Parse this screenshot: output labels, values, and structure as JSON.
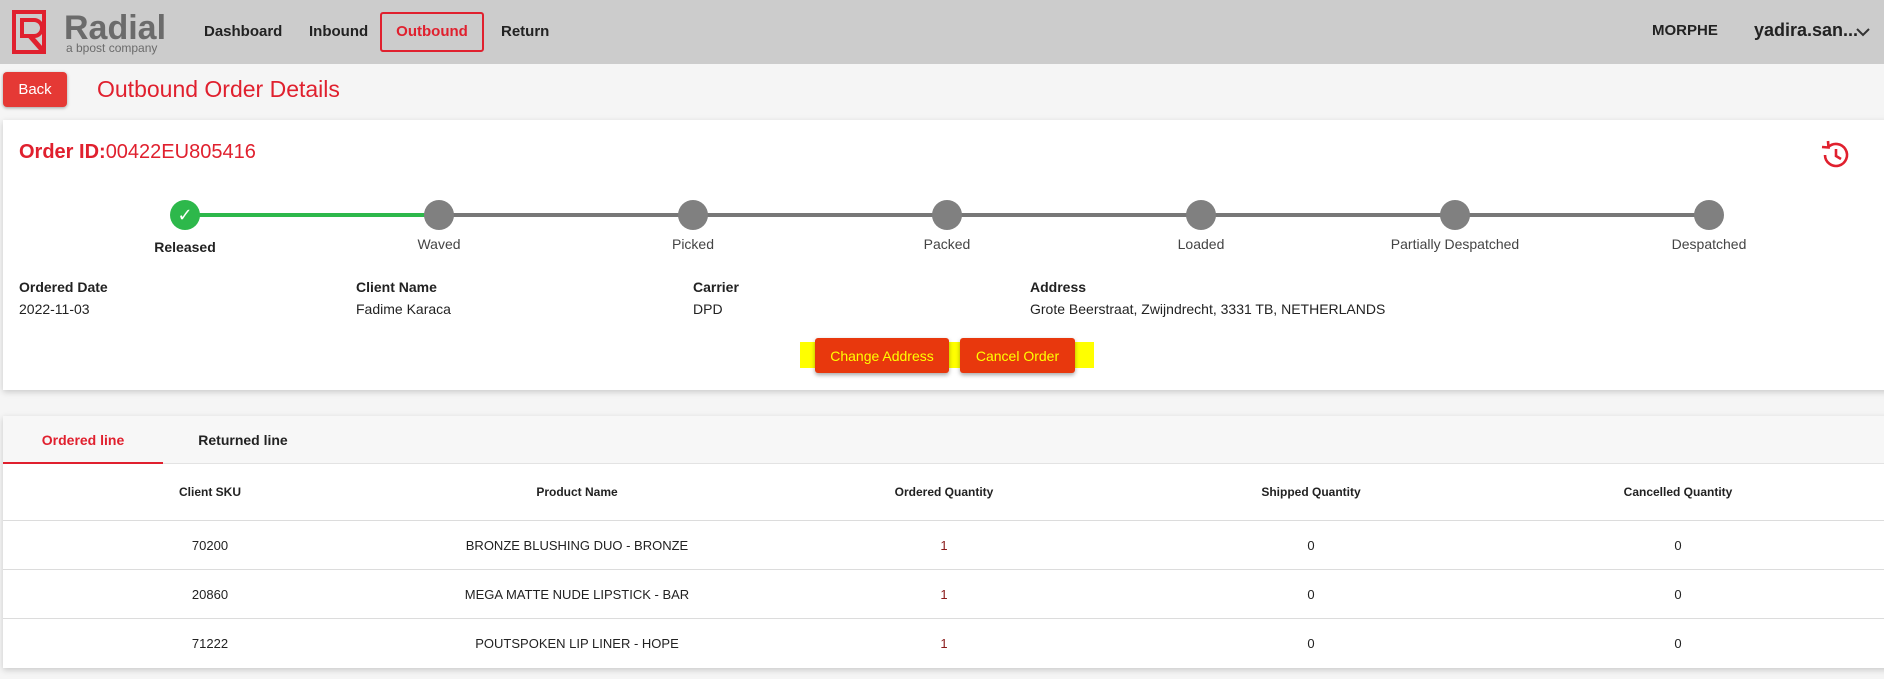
{
  "brand": {
    "name": "Radial",
    "tagline": "a bpost company",
    "color": "#e0202e"
  },
  "nav": {
    "items": [
      {
        "label": "Dashboard",
        "active": false
      },
      {
        "label": "Inbound",
        "active": false
      },
      {
        "label": "Outbound",
        "active": true
      },
      {
        "label": "Return",
        "active": false
      }
    ],
    "client": "MORPHE",
    "user": "yadira.san..."
  },
  "header": {
    "back_label": "Back",
    "title": "Outbound Order Details"
  },
  "order": {
    "id_label": "Order ID:",
    "id_value": "00422EU805416",
    "history_icon": "history-icon"
  },
  "progress": {
    "current_step": "Released",
    "steps": [
      "Released",
      "Waved",
      "Picked",
      "Packed",
      "Loaded",
      "Partially Despatched",
      "Despatched"
    ]
  },
  "details": {
    "ordered_date": {
      "label": "Ordered Date",
      "value": "2022-11-03"
    },
    "client_name": {
      "label": "Client Name",
      "value": "Fadime Karaca"
    },
    "carrier": {
      "label": "Carrier",
      "value": "DPD"
    },
    "address": {
      "label": "Address",
      "value": "Grote Beerstraat, Zwijndrecht, 3331 TB, NETHERLANDS"
    }
  },
  "actions": {
    "change_address": "Change Address",
    "cancel_order": "Cancel Order"
  },
  "tabs": [
    {
      "label": "Ordered line",
      "active": true
    },
    {
      "label": "Returned line",
      "active": false
    }
  ],
  "table": {
    "columns": [
      "Client SKU",
      "Product Name",
      "Ordered Quantity",
      "Shipped Quantity",
      "Cancelled Quantity"
    ],
    "rows": [
      [
        "70200",
        "BRONZE BLUSHING DUO - BRONZE",
        "1",
        "0",
        "0"
      ],
      [
        "20860",
        "MEGA MATTE NUDE LIPSTICK - BAR",
        "1",
        "0",
        "0"
      ],
      [
        "71222",
        "POUTSPOKEN LIP LINER - HOPE",
        "1",
        "0",
        "0"
      ]
    ]
  },
  "colors": {
    "accent": "#e0202e",
    "done": "#2db84b",
    "pending": "#808080",
    "highlight": "#ffff00",
    "action": "#e8380d"
  }
}
